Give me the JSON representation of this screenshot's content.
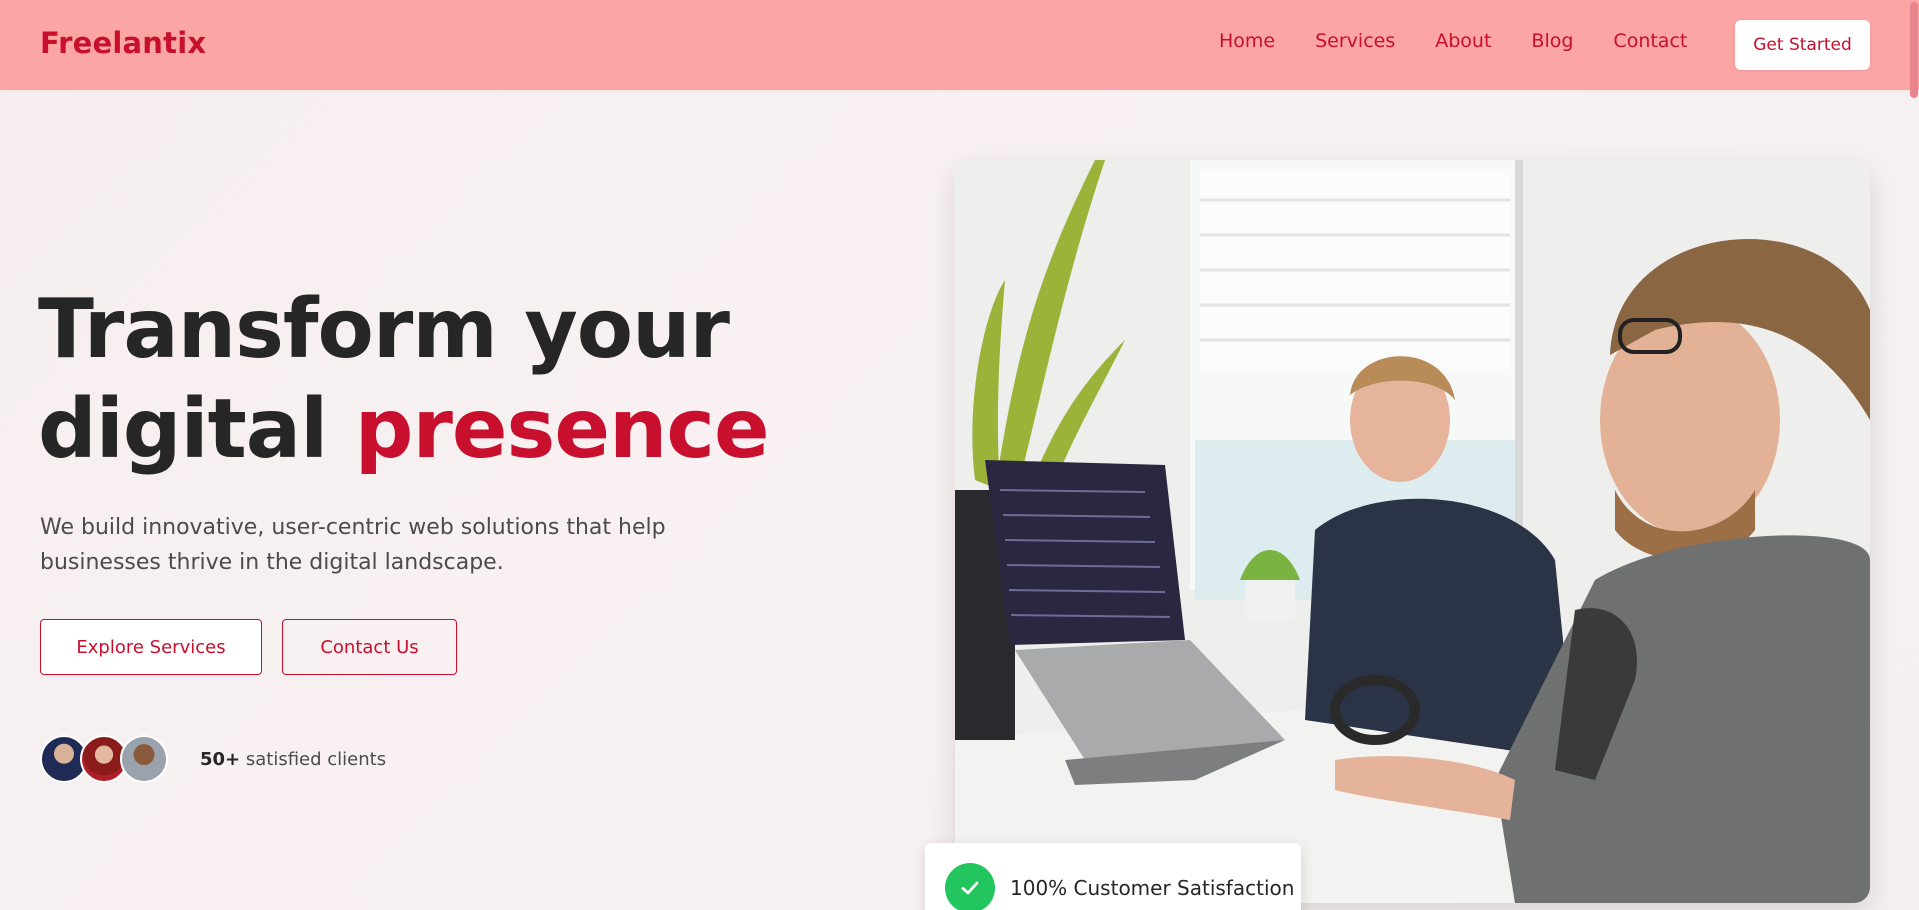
{
  "header": {
    "brand": "Freelantix",
    "nav": [
      {
        "label": "Home"
      },
      {
        "label": "Services"
      },
      {
        "label": "About"
      },
      {
        "label": "Blog"
      },
      {
        "label": "Contact"
      }
    ],
    "cta_label": "Get Started"
  },
  "hero": {
    "title_line1": "Transform your",
    "title_line2_plain": "digital ",
    "title_line2_accent": "presence",
    "subtitle": "We build innovative, user-centric web solutions that help businesses thrive in the digital landscape.",
    "primary_button": "Explore Services",
    "secondary_button": "Contact Us",
    "clients_count": "50+",
    "clients_label": " satisfied clients"
  },
  "badge": {
    "text": "100% Customer Satisfaction",
    "icon": "check-icon"
  },
  "colors": {
    "brand": "#c8102e",
    "header_bg": "#fca5a5",
    "success": "#22c55e"
  }
}
